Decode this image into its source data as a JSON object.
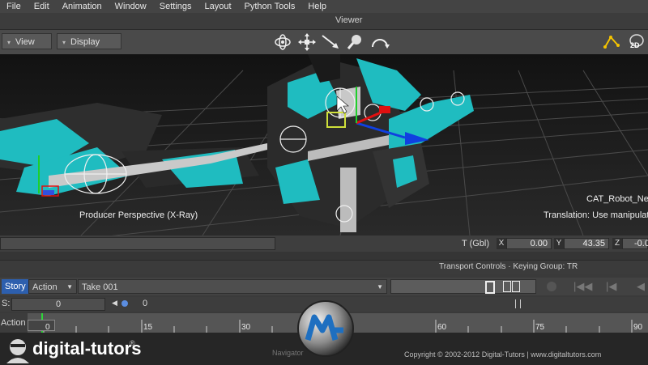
{
  "menu": [
    "File",
    "Edit",
    "Animation",
    "Window",
    "Settings",
    "Layout",
    "Python Tools",
    "Help"
  ],
  "viewer_title": "Viewer",
  "toolbar": {
    "view_label": "View",
    "display_label": "Display",
    "mode_2d": "2D"
  },
  "viewport": {
    "camera_label": "Producer Perspective (X-Ray)",
    "selection_label": "CAT_Robot_Ne",
    "status_label": "Translation: Use manipulato"
  },
  "coords": {
    "label": "T (Gbl)",
    "x_axis": "X",
    "x": "0.00",
    "y_axis": "Y",
    "y": "43.35",
    "z_axis": "Z",
    "z": "-0.0"
  },
  "transport": {
    "title": "Transport Controls  ·  Keying Group: TR"
  },
  "story": {
    "story_tab": "Story",
    "action_tab": "Action",
    "take": "Take 001"
  },
  "second_row": {
    "s_label": "S:",
    "s_value": "0",
    "cursor_value": "0"
  },
  "timeline": {
    "mode": "Action",
    "current_frame": "0",
    "ticks": [
      "0",
      "15",
      "30",
      "60",
      "75",
      "90"
    ]
  },
  "footer": {
    "brand": "digital-tutors",
    "trademark": "®",
    "navigator": "Navigator",
    "copyright": "Copyright © 2002-2012 Digital-Tutors  |  www.digitaltutors.com"
  },
  "colors": {
    "accent_teal": "#1fbcc0",
    "robot_dark": "#2b2b2b",
    "manip_red": "#e01010",
    "manip_blue": "#1040e0",
    "manip_green": "#1fcf2a"
  }
}
